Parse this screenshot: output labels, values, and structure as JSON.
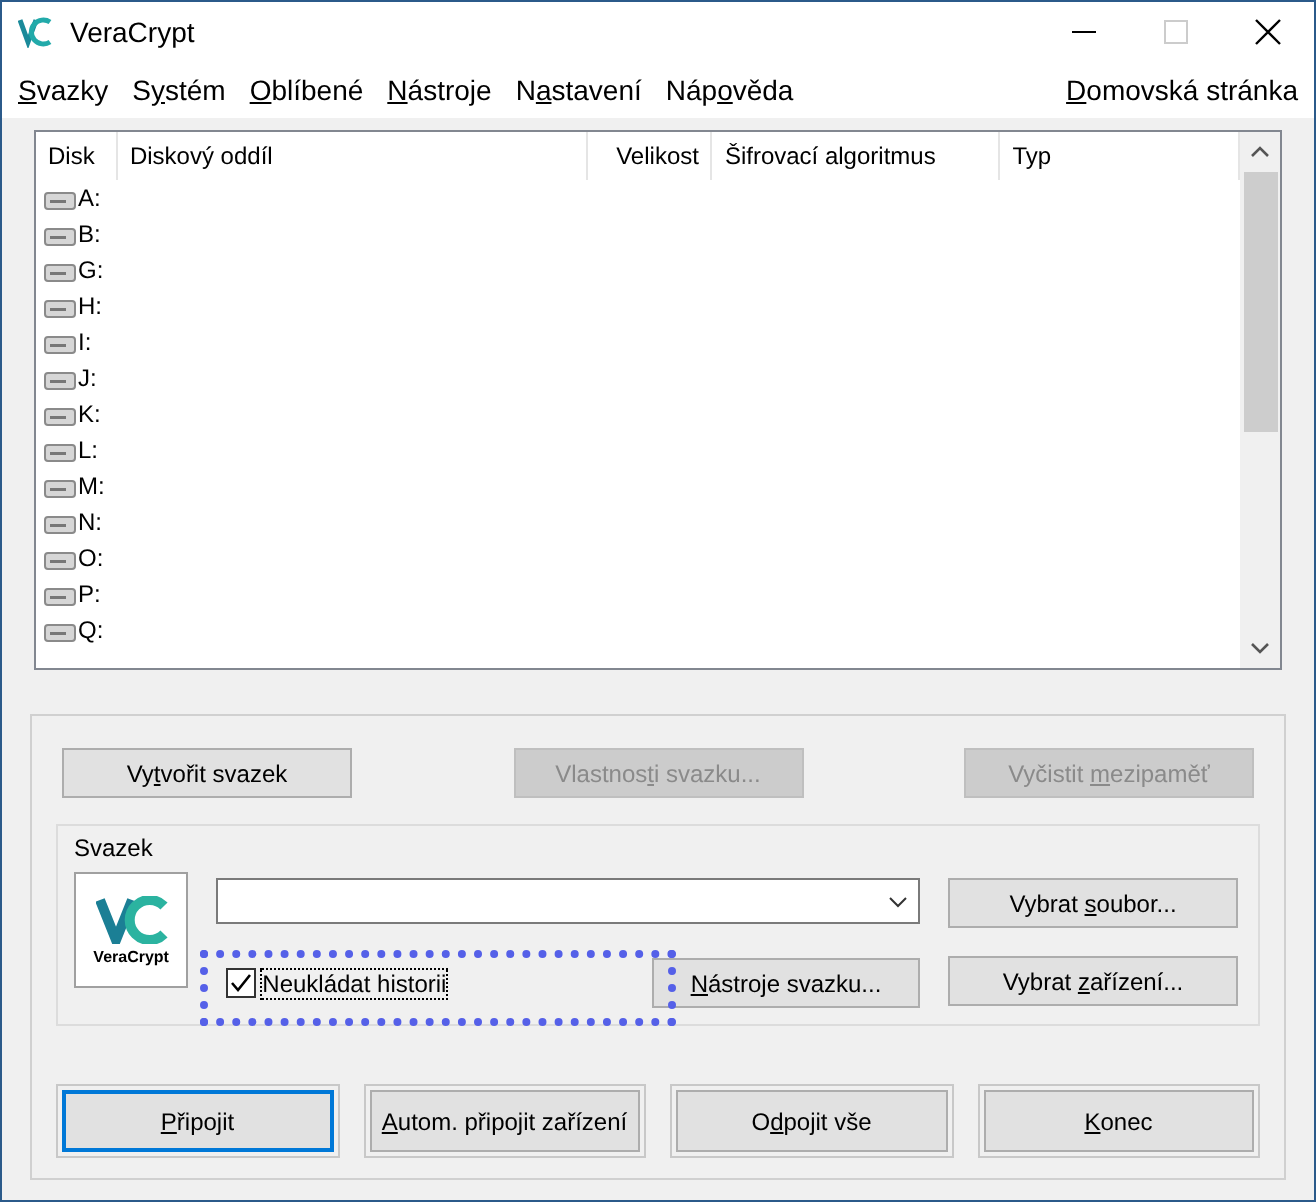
{
  "window": {
    "title": "VeraCrypt"
  },
  "menu": [
    {
      "label": {
        "key": "S",
        "post": "vazky"
      }
    },
    {
      "label": {
        "pre": "S",
        "key": "y",
        "post": "stém"
      }
    },
    {
      "label": {
        "key": "O",
        "post": "blíbené"
      }
    },
    {
      "label": {
        "key": "N",
        "post": "ástroje"
      }
    },
    {
      "label": {
        "pre": "N",
        "key": "a",
        "post": "stavení"
      }
    },
    {
      "label": {
        "pre": "Náp",
        "key": "o",
        "post": "věda"
      }
    }
  ],
  "homepage_link": {
    "label": {
      "key": "D",
      "post": "omovská stránka"
    }
  },
  "drive_list": {
    "columns": [
      "Disk",
      "Diskový oddíl",
      "Velikost",
      "Šifrovací algoritmus",
      "Typ"
    ],
    "rows": [
      "A:",
      "B:",
      "G:",
      "H:",
      "I:",
      "J:",
      "K:",
      "L:",
      "M:",
      "N:",
      "O:",
      "P:",
      "Q:"
    ]
  },
  "top_buttons": [
    {
      "label": {
        "pre": "Vy",
        "key": "t",
        "post": "vořit svazek"
      },
      "disabled": false
    },
    {
      "label": {
        "pre": "Vlastnos",
        "key": "t",
        "post": "i svazku..."
      },
      "disabled": true
    },
    {
      "label": {
        "pre": "Vyčistit ",
        "key": "m",
        "post": "ezipaměť"
      },
      "disabled": true
    }
  ],
  "volume_group": {
    "title": "Svazek",
    "logo_text": "VeraCrypt",
    "history_checkbox": {
      "label": "Neukládat historii",
      "checked": true
    },
    "side_buttons": [
      {
        "label": {
          "pre": "Vybrat ",
          "key": "s",
          "post": "oubor..."
        }
      },
      {
        "label": {
          "pre": "Vybrat ",
          "key": "z",
          "post": "ařízení..."
        }
      }
    ],
    "tools_button": {
      "label": {
        "key": "N",
        "post": "ástroje svazku..."
      }
    }
  },
  "bottom_buttons": [
    {
      "label": {
        "key": "P",
        "post": "řipojit"
      },
      "default": true
    },
    {
      "label": {
        "key": "A",
        "post": "utom. připojit zařízení"
      },
      "default": false
    },
    {
      "label": {
        "pre": "O",
        "key": "d",
        "post": "pojit vše"
      },
      "default": false
    },
    {
      "label": {
        "key": "K",
        "post": "onec"
      },
      "default": false
    }
  ]
}
